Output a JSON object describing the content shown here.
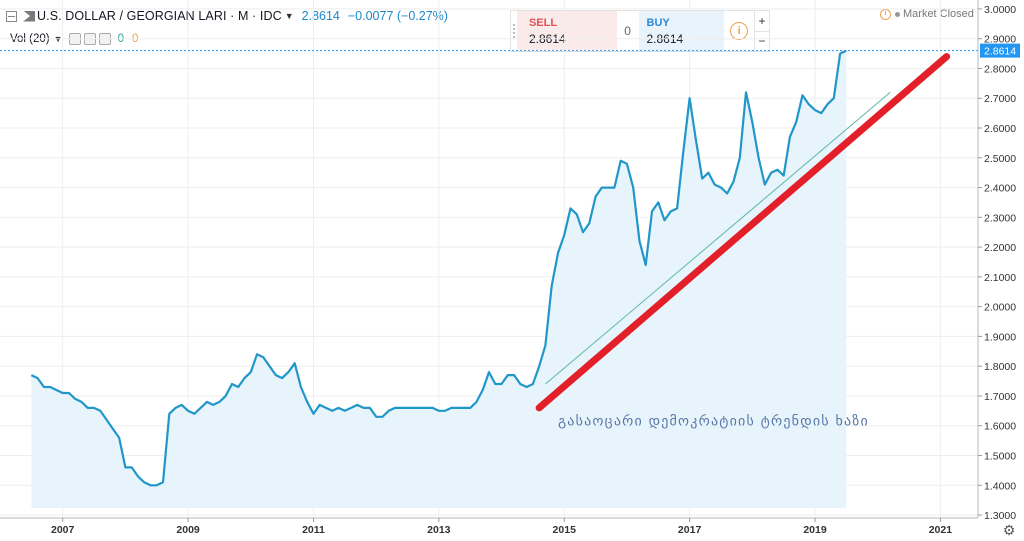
{
  "header": {
    "symbol": "U.S. DOLLAR / GEORGIAN LARI · M · IDC",
    "last": "2.8614",
    "change": "−0.0077 (−0.27%)",
    "volume_label": "Vol (20)",
    "volume_value_1": "0",
    "volume_value_2": "0"
  },
  "trade": {
    "sell_label": "SELL",
    "sell_price": "2.8614",
    "spread": "0",
    "buy_label": "BUY",
    "buy_price": "2.8614",
    "plus": "+",
    "minus": "−"
  },
  "market_status": "Market Closed",
  "price_tag": "2.8614",
  "colors": {
    "price_line": "#2196c9",
    "price_fill": "#e8f4fb",
    "trend_line": "#e3202a",
    "trend_thin": "#5cb8a8",
    "price_tag_bg": "#2196f3"
  },
  "chart_data": {
    "type": "area",
    "ylim": [
      1.29,
      3.03
    ],
    "xlim": [
      2006.0,
      2021.6
    ],
    "y_ticks": [
      {
        "value": 3.0,
        "label": "3.0000"
      },
      {
        "value": 2.9,
        "label": "2.9000"
      },
      {
        "value": 2.8,
        "label": "2.8000"
      },
      {
        "value": 2.7,
        "label": "2.7000"
      },
      {
        "value": 2.6,
        "label": "2.6000"
      },
      {
        "value": 2.5,
        "label": "2.5000"
      },
      {
        "value": 2.4,
        "label": "2.4000"
      },
      {
        "value": 2.3,
        "label": "2.3000"
      },
      {
        "value": 2.2,
        "label": "2.2000"
      },
      {
        "value": 2.1,
        "label": "2.1000"
      },
      {
        "value": 2.0,
        "label": "2.0000"
      },
      {
        "value": 1.9,
        "label": "1.9000"
      },
      {
        "value": 1.8,
        "label": "1.8000"
      },
      {
        "value": 1.7,
        "label": "1.7000"
      },
      {
        "value": 1.6,
        "label": "1.6000"
      },
      {
        "value": 1.5,
        "label": "1.5000"
      },
      {
        "value": 1.4,
        "label": "1.4000"
      },
      {
        "value": 1.3,
        "label": "1.3000"
      }
    ],
    "x_ticks": [
      {
        "value": 2007.0,
        "label": "2007"
      },
      {
        "value": 2009.0,
        "label": "2009"
      },
      {
        "value": 2011.0,
        "label": "2011"
      },
      {
        "value": 2013.0,
        "label": "2013"
      },
      {
        "value": 2015.0,
        "label": "2015"
      },
      {
        "value": 2017.0,
        "label": "2017"
      },
      {
        "value": 2019.0,
        "label": "2019"
      },
      {
        "value": 2021.0,
        "label": "2021"
      }
    ],
    "series": [
      {
        "x": [
          2006.5,
          2006.6,
          2006.7,
          2006.8,
          2006.9,
          2007.0,
          2007.1,
          2007.2,
          2007.3,
          2007.4,
          2007.5,
          2007.6,
          2007.7,
          2007.8,
          2007.9,
          2008.0,
          2008.1,
          2008.2,
          2008.3,
          2008.4,
          2008.5,
          2008.6,
          2008.7,
          2008.8,
          2008.9,
          2009.0,
          2009.1,
          2009.2,
          2009.3,
          2009.4,
          2009.5,
          2009.6,
          2009.7,
          2009.8,
          2009.9,
          2010.0,
          2010.1,
          2010.2,
          2010.3,
          2010.4,
          2010.5,
          2010.6,
          2010.7,
          2010.8,
          2010.9,
          2011.0,
          2011.1,
          2011.2,
          2011.3,
          2011.4,
          2011.5,
          2011.6,
          2011.7,
          2011.8,
          2011.9,
          2012.0,
          2012.1,
          2012.2,
          2012.3,
          2012.4,
          2012.5,
          2012.6,
          2012.7,
          2012.8,
          2012.9,
          2013.0,
          2013.1,
          2013.2,
          2013.3,
          2013.4,
          2013.5,
          2013.6,
          2013.7,
          2013.8,
          2013.9,
          2014.0,
          2014.1,
          2014.2,
          2014.3,
          2014.4,
          2014.5,
          2014.6,
          2014.7,
          2014.8,
          2014.9,
          2015.0,
          2015.1,
          2015.2,
          2015.3,
          2015.4,
          2015.5,
          2015.6,
          2015.7,
          2015.8,
          2015.9,
          2016.0,
          2016.1,
          2016.2,
          2016.3,
          2016.4,
          2016.5,
          2016.6,
          2016.7,
          2016.8,
          2016.9,
          2017.0,
          2017.1,
          2017.2,
          2017.3,
          2017.4,
          2017.5,
          2017.6,
          2017.7,
          2017.8,
          2017.9,
          2018.0,
          2018.1,
          2018.2,
          2018.3,
          2018.4,
          2018.5,
          2018.6,
          2018.7,
          2018.8,
          2018.9,
          2019.0,
          2019.1,
          2019.2,
          2019.3,
          2019.4,
          2019.5
        ],
        "values": [
          1.77,
          1.76,
          1.73,
          1.73,
          1.72,
          1.71,
          1.71,
          1.69,
          1.68,
          1.66,
          1.66,
          1.65,
          1.62,
          1.59,
          1.56,
          1.46,
          1.46,
          1.43,
          1.41,
          1.4,
          1.4,
          1.41,
          1.64,
          1.66,
          1.67,
          1.65,
          1.64,
          1.66,
          1.68,
          1.67,
          1.68,
          1.7,
          1.74,
          1.73,
          1.76,
          1.78,
          1.84,
          1.83,
          1.8,
          1.77,
          1.76,
          1.78,
          1.81,
          1.73,
          1.68,
          1.64,
          1.67,
          1.66,
          1.65,
          1.66,
          1.65,
          1.66,
          1.67,
          1.66,
          1.66,
          1.63,
          1.63,
          1.65,
          1.66,
          1.66,
          1.66,
          1.66,
          1.66,
          1.66,
          1.66,
          1.65,
          1.65,
          1.66,
          1.66,
          1.66,
          1.66,
          1.68,
          1.72,
          1.78,
          1.74,
          1.74,
          1.77,
          1.77,
          1.74,
          1.73,
          1.74,
          1.8,
          1.87,
          2.07,
          2.18,
          2.24,
          2.33,
          2.31,
          2.25,
          2.28,
          2.37,
          2.4,
          2.4,
          2.4,
          2.49,
          2.48,
          2.4,
          2.22,
          2.14,
          2.32,
          2.35,
          2.29,
          2.32,
          2.33,
          2.52,
          2.7,
          2.56,
          2.43,
          2.45,
          2.41,
          2.4,
          2.38,
          2.42,
          2.5,
          2.72,
          2.62,
          2.5,
          2.41,
          2.45,
          2.46,
          2.44,
          2.57,
          2.62,
          2.71,
          2.68,
          2.66,
          2.65,
          2.68,
          2.7,
          2.85,
          2.86
        ]
      }
    ],
    "trend_line": {
      "x": [
        2014.6,
        2021.1
      ],
      "y": [
        1.66,
        2.84
      ]
    },
    "thin_trend_line": {
      "x": [
        2014.7,
        2020.2
      ],
      "y": [
        1.74,
        2.72
      ]
    },
    "annotation": "გასაოცარი დემოკრატიის ტრენდის ხაზი"
  }
}
